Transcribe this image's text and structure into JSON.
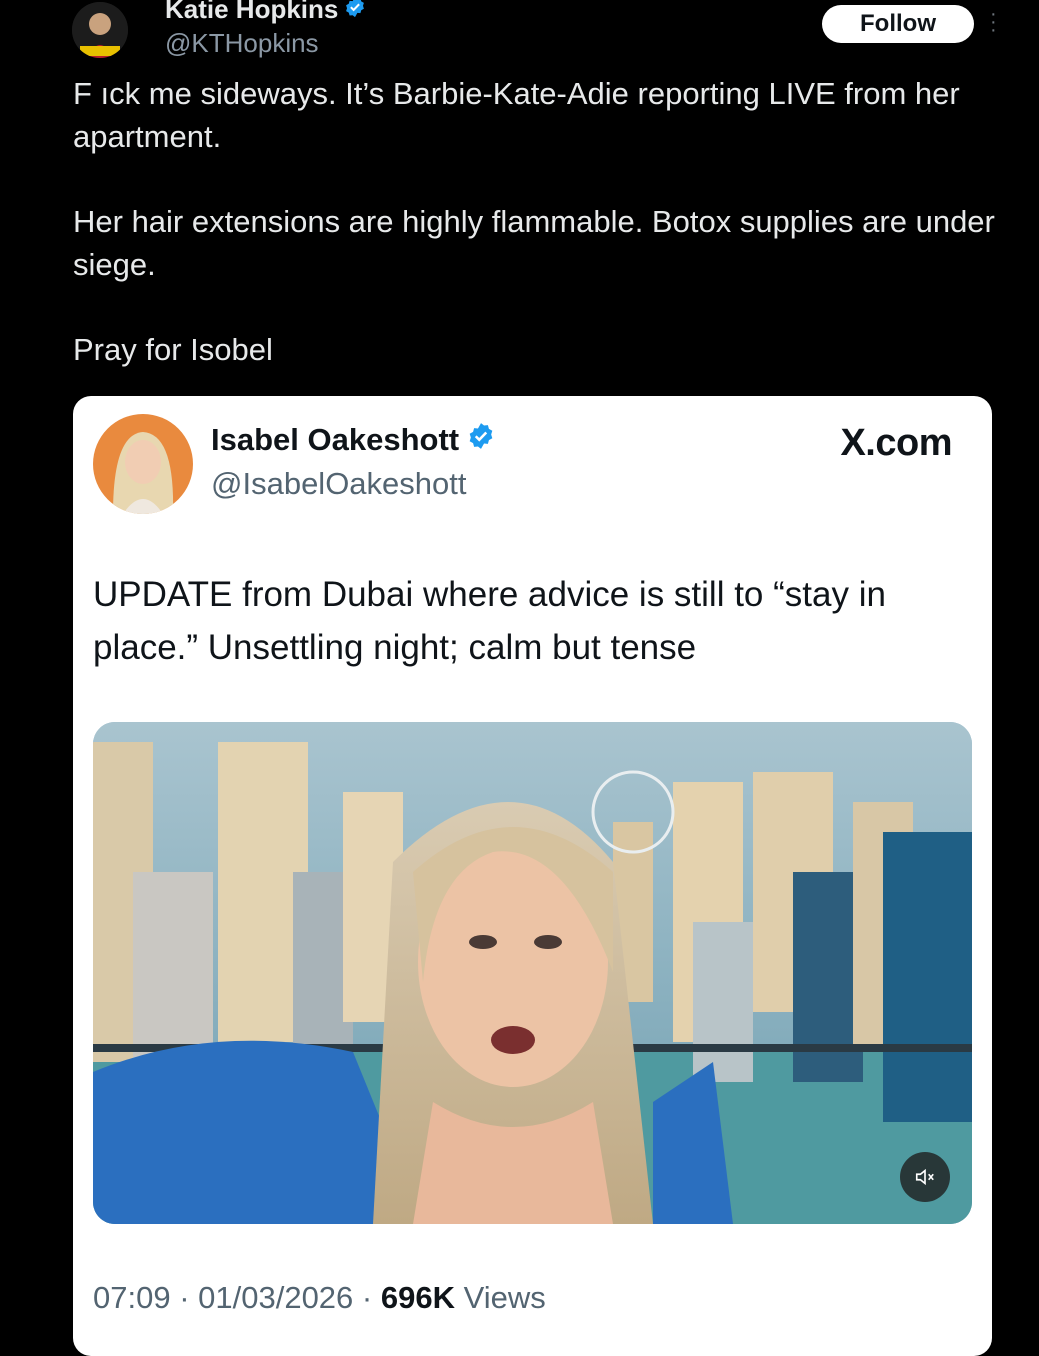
{
  "post": {
    "author_name": "Katie Hopkins",
    "author_handle": "@KTHopkins",
    "follow_label": "Follow",
    "paragraphs": [
      "F ıck me sideways. It’s Barbie-Kate-Adie reporting LIVE from her apartment.",
      "Her hair extensions are highly flammable. Botox supplies are under siege.",
      "Pray for Isobel"
    ]
  },
  "quoted": {
    "author_name": "Isabel Oakeshott",
    "author_handle": "@IsabelOakeshott",
    "site_label": "X.com",
    "text": "UPDATE from Dubai where advice is still to “stay in place.” Unsettling night; calm but tense",
    "time": "07:09",
    "date": "01/03/2026",
    "views_count": "696K",
    "views_label": "Views",
    "separator": " · "
  },
  "colors": {
    "background": "#000000",
    "verified_badge": "#1d9bf0",
    "card_background": "#ffffff"
  },
  "icons": [
    "verified-badge-icon",
    "more-options-icon",
    "mute-icon"
  ]
}
